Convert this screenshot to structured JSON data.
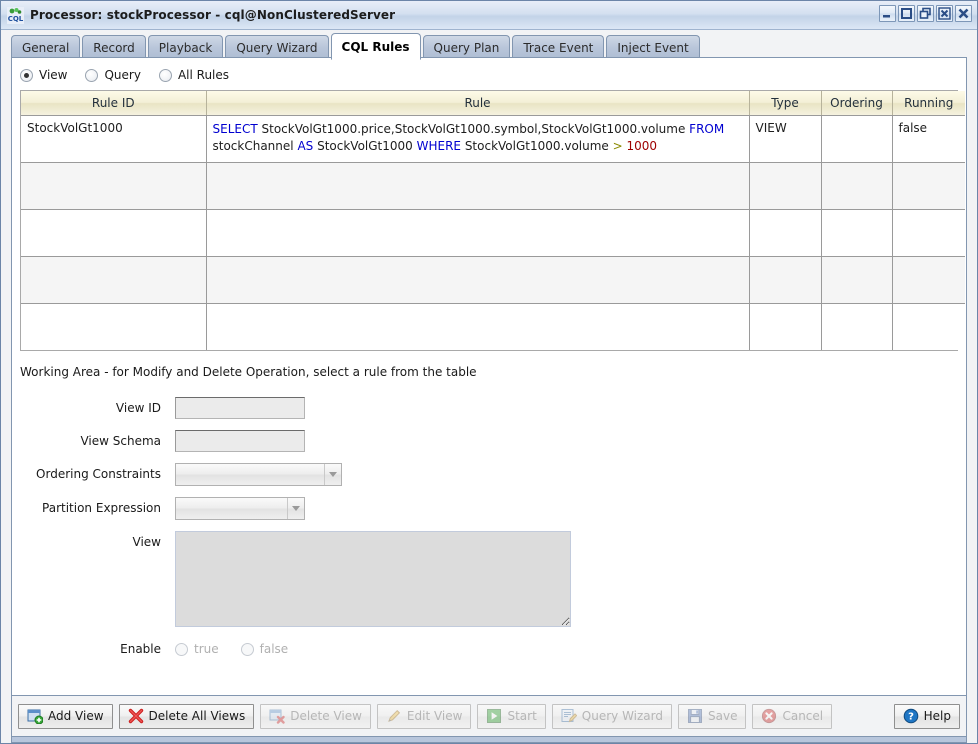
{
  "window": {
    "title": "Processor: stockProcessor - cql@NonClusteredServer",
    "icon": "cql-app-icon",
    "controls": [
      {
        "name": "minimize-button",
        "glyph": "_"
      },
      {
        "name": "maximize-button",
        "glyph": "□"
      },
      {
        "name": "restore-button",
        "glyph": "❐"
      },
      {
        "name": "close-window-button",
        "glyph": "x"
      },
      {
        "name": "close-all-button",
        "glyph": "✖"
      }
    ]
  },
  "tabs": [
    {
      "label": "General",
      "active": false
    },
    {
      "label": "Record",
      "active": false
    },
    {
      "label": "Playback",
      "active": false
    },
    {
      "label": "Query Wizard",
      "active": false
    },
    {
      "label": "CQL Rules",
      "active": true
    },
    {
      "label": "Query Plan",
      "active": false
    },
    {
      "label": "Trace Event",
      "active": false
    },
    {
      "label": "Inject Event",
      "active": false
    }
  ],
  "filter": {
    "options": [
      {
        "label": "View",
        "selected": true
      },
      {
        "label": "Query",
        "selected": false
      },
      {
        "label": "All Rules",
        "selected": false
      }
    ]
  },
  "table": {
    "columns": [
      "Rule ID",
      "Rule",
      "Type",
      "Ordering",
      "Running"
    ],
    "rows": [
      {
        "rule_id": "StockVolGt1000",
        "rule_tokens": [
          {
            "t": "SELECT",
            "c": "kw"
          },
          {
            "t": " StockVolGt1000.price,StockVolGt1000.symbol,StockVolGt1000.volume ",
            "c": ""
          },
          {
            "t": "FROM",
            "c": "kw"
          },
          {
            "t": " stockChannel ",
            "c": ""
          },
          {
            "t": "AS",
            "c": "kw"
          },
          {
            "t": " StockVolGt1000 ",
            "c": ""
          },
          {
            "t": "WHERE",
            "c": "kw"
          },
          {
            "t": " StockVolGt1000.volume ",
            "c": ""
          },
          {
            "t": ">",
            "c": "op"
          },
          {
            "t": " ",
            "c": ""
          },
          {
            "t": "1000",
            "c": "num"
          }
        ],
        "type": "VIEW",
        "ordering": "",
        "running": "false"
      },
      {
        "rule_id": "",
        "rule_tokens": [],
        "type": "",
        "ordering": "",
        "running": ""
      },
      {
        "rule_id": "",
        "rule_tokens": [],
        "type": "",
        "ordering": "",
        "running": ""
      },
      {
        "rule_id": "",
        "rule_tokens": [],
        "type": "",
        "ordering": "",
        "running": ""
      },
      {
        "rule_id": "",
        "rule_tokens": [],
        "type": "",
        "ordering": "",
        "running": ""
      }
    ]
  },
  "working_area": {
    "title": "Working Area - for Modify and Delete Operation, select a rule from the table",
    "fields": {
      "view_id_label": "View ID",
      "view_id_value": "",
      "view_schema_label": "View Schema",
      "view_schema_value": "",
      "ordering_constraints_label": "Ordering Constraints",
      "ordering_constraints_value": "",
      "partition_expression_label": "Partition Expression",
      "partition_expression_value": "",
      "view_label": "View",
      "view_value": "",
      "enable_label": "Enable",
      "enable_true": "true",
      "enable_false": "false"
    }
  },
  "buttons": [
    {
      "label": "Add View",
      "icon": "add-view-icon",
      "enabled": true
    },
    {
      "label": "Delete All Views",
      "icon": "delete-all-icon",
      "enabled": true
    },
    {
      "label": "Delete View",
      "icon": "delete-view-icon",
      "enabled": false
    },
    {
      "label": "Edit View",
      "icon": "edit-pencil-icon",
      "enabled": false
    },
    {
      "label": "Start",
      "icon": "play-icon",
      "enabled": false
    },
    {
      "label": "Query Wizard",
      "icon": "query-wizard-icon",
      "enabled": false
    },
    {
      "label": "Save",
      "icon": "save-floppy-icon",
      "enabled": false
    },
    {
      "label": "Cancel",
      "icon": "cancel-icon",
      "enabled": false
    },
    {
      "label": "Help",
      "icon": "help-icon",
      "enabled": true
    }
  ],
  "colors": {
    "keyword": "#0000d0",
    "operator": "#8a8a00",
    "number": "#9e0000",
    "header_bg": "#f3efd6",
    "titlebar": "#c3d3e8"
  }
}
